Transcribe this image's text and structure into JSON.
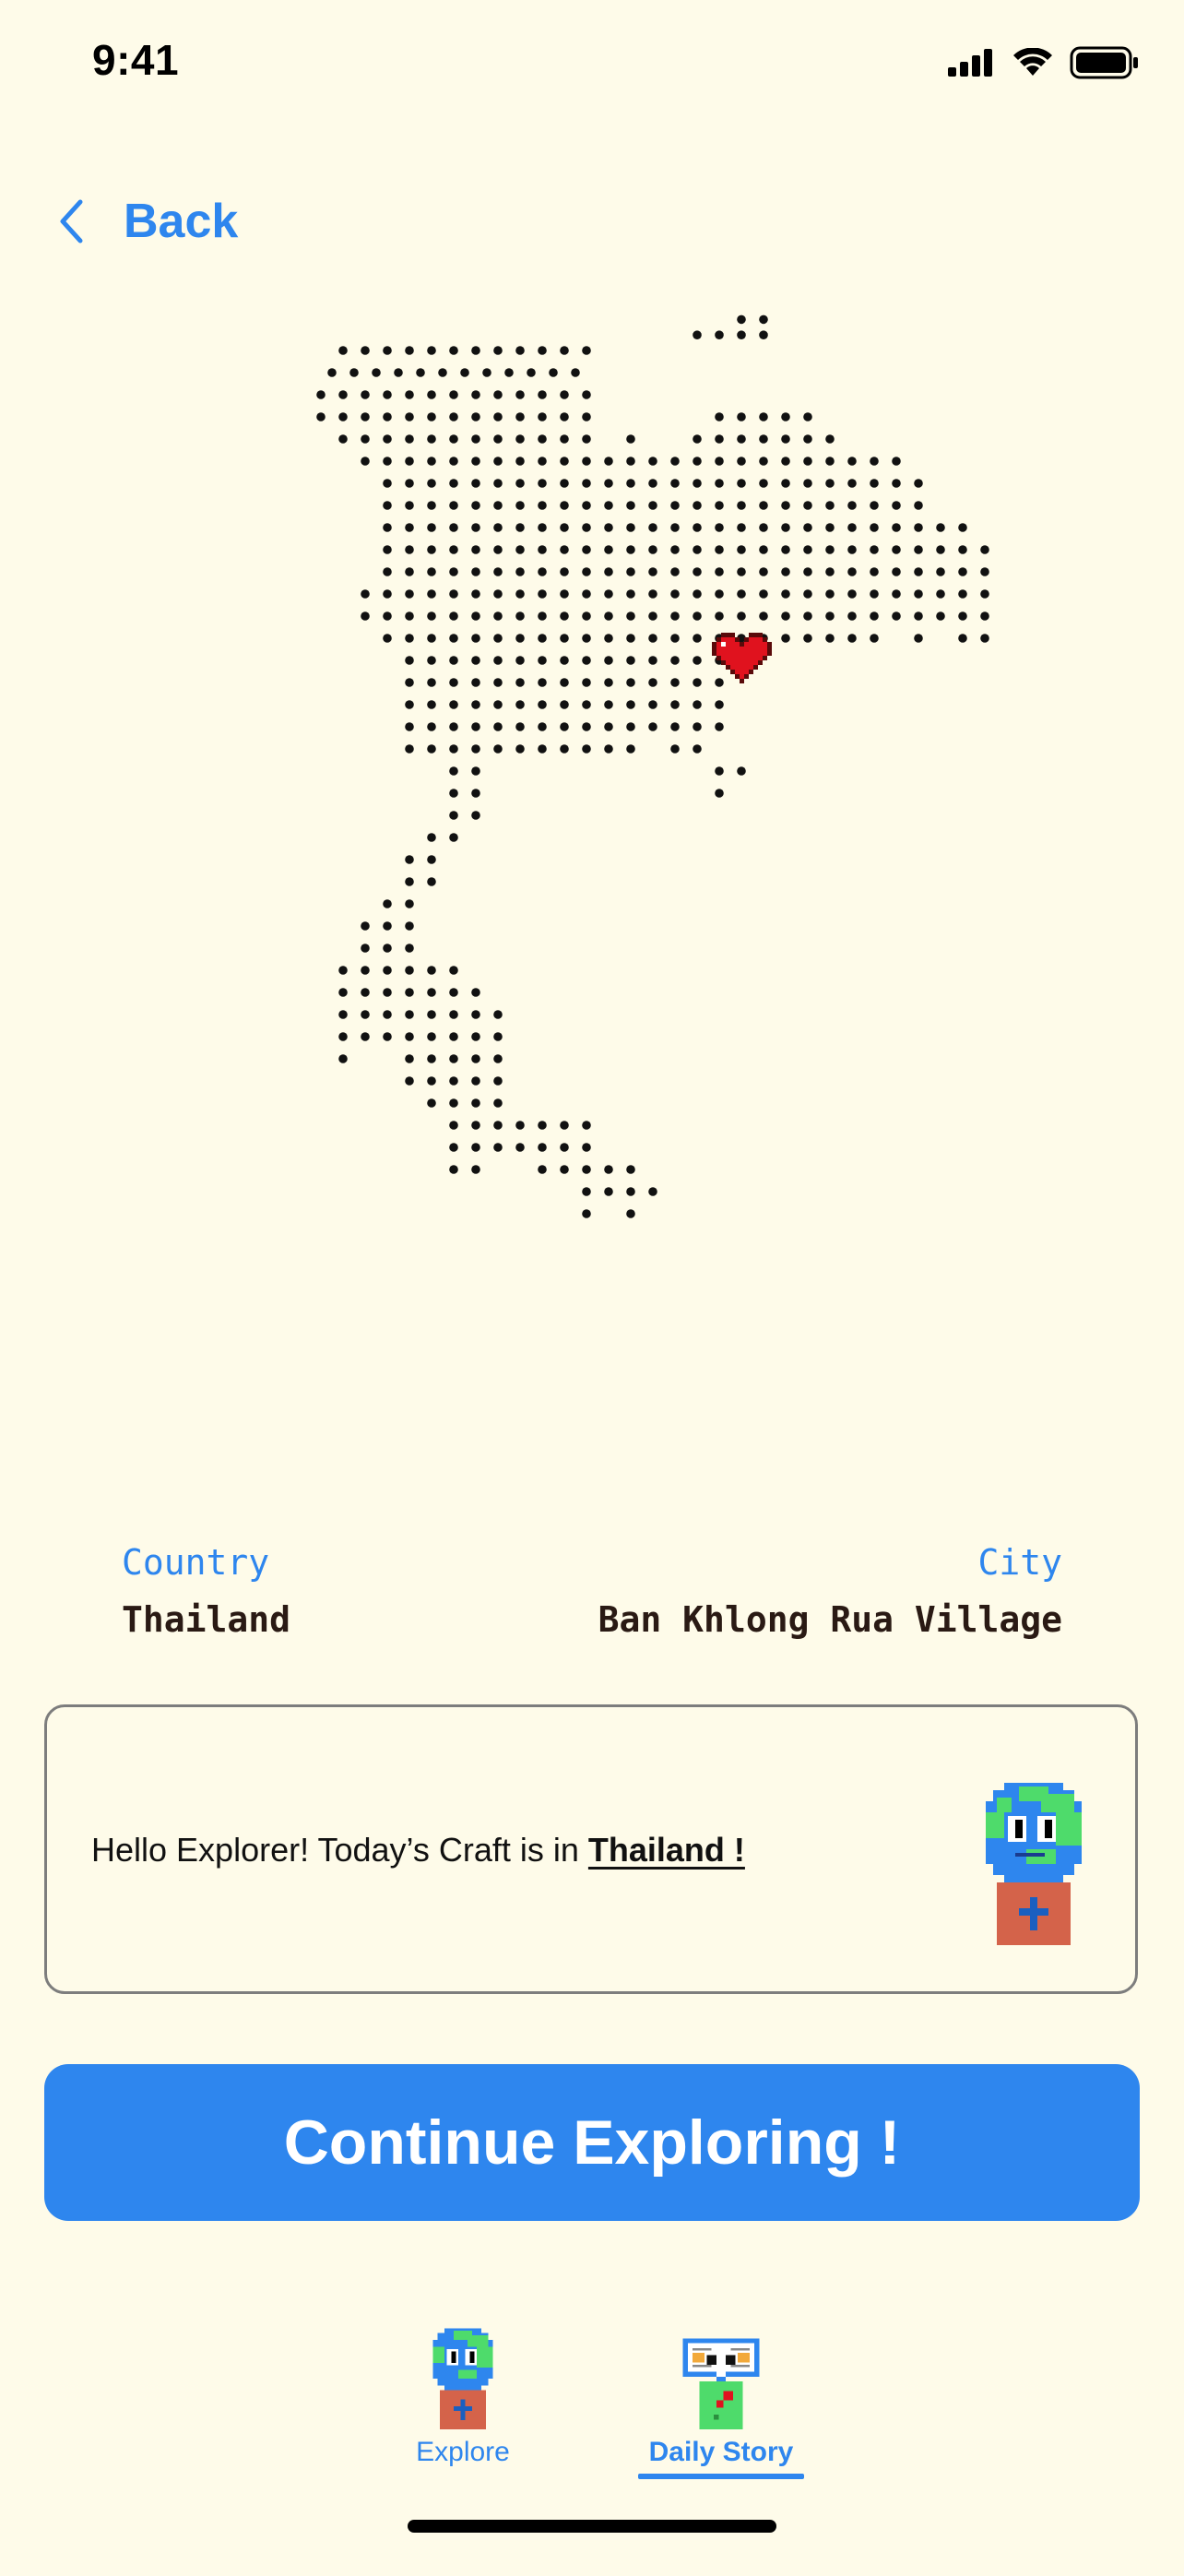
{
  "status_bar": {
    "time": "9:41",
    "icons": [
      "signal-icon",
      "wifi-icon",
      "battery-icon"
    ]
  },
  "nav": {
    "back_label": "Back"
  },
  "map": {
    "marker": "heart-icon",
    "shape": "Thailand dot map"
  },
  "location": {
    "country_label": "Country",
    "country_value": "Thailand",
    "city_label": "City",
    "city_value": "Ban Khlong Rua Village"
  },
  "message": {
    "prefix": "Hello Explorer! Today’s Craft is in ",
    "highlight": "Thailand !",
    "avatar": "globe-explorer-avatar"
  },
  "cta": {
    "label": "Continue Exploring !"
  },
  "tabs": [
    {
      "label": "Explore",
      "icon": "globe-explorer-icon",
      "active": false
    },
    {
      "label": "Daily Story",
      "icon": "story-character-icon",
      "active": true
    }
  ],
  "colors": {
    "background": "#FEFBE9",
    "accent": "#2E86EE",
    "heart": "#E0121E"
  }
}
